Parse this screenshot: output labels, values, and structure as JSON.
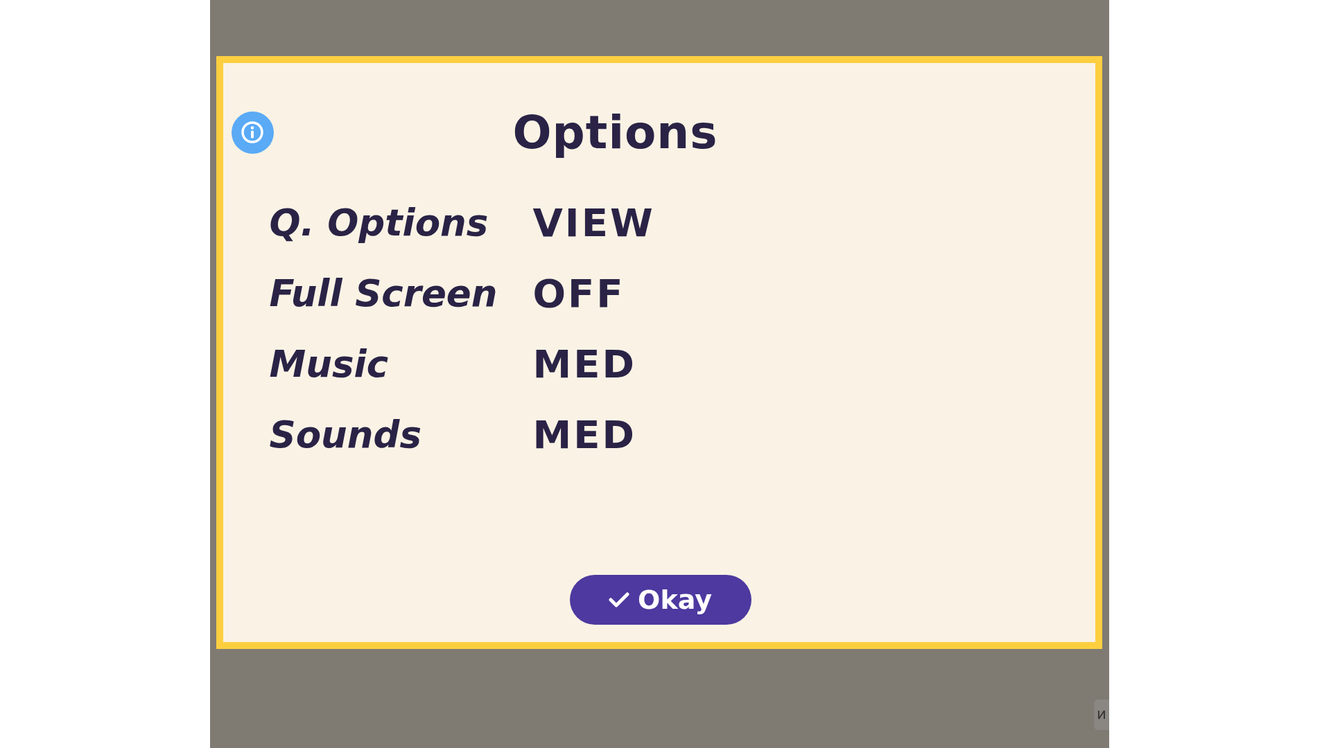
{
  "dialog": {
    "title": "Options",
    "settings": [
      {
        "label": "Q. Options",
        "value": "VIEW"
      },
      {
        "label": "Full Screen",
        "value": "OFF"
      },
      {
        "label": "Music",
        "value": "MED"
      },
      {
        "label": "Sounds",
        "value": "MED"
      }
    ],
    "confirm_button": {
      "label": "Okay"
    }
  }
}
